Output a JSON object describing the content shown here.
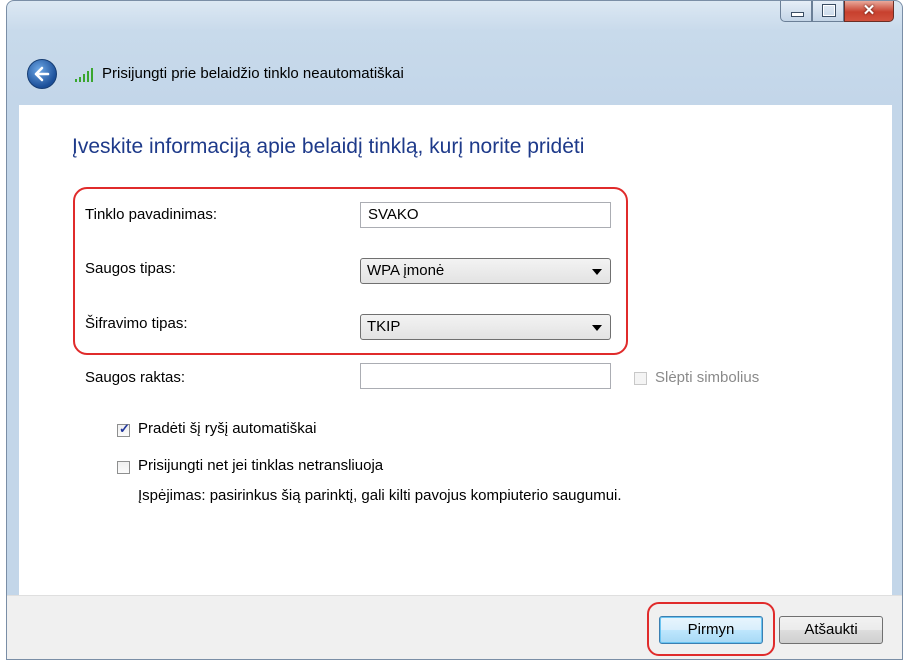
{
  "window": {
    "title": "Prisijungti prie belaidžio tinklo neautomatiškai",
    "controls": {
      "minimize": "minimize-icon",
      "maximize": "maximize-icon",
      "close": "close-icon"
    }
  },
  "form": {
    "heading": "Įveskite informaciją apie belaidį tinklą, kurį norite pridėti",
    "network_name": {
      "label": "Tinklo pavadinimas:",
      "value": "SVAKO"
    },
    "security_type": {
      "label": "Saugos tipas:",
      "value": "WPA įmonė"
    },
    "encryption_type": {
      "label": "Šifravimo tipas:",
      "value": "TKIP"
    },
    "security_key": {
      "label": "Saugos raktas:",
      "value": ""
    },
    "hide_characters": {
      "label": "Slėpti simbolius",
      "checked": false,
      "enabled": false
    },
    "start_automatically": {
      "label": "Pradėti šį ryšį automatiškai",
      "checked": true
    },
    "connect_if_not_broadcasting": {
      "label": "Prisijungti net jei tinklas netransliuoja",
      "checked": false
    },
    "warning": "Įspėjimas: pasirinkus šią parinktį, gali kilti pavojus kompiuterio saugumui."
  },
  "buttons": {
    "next": "Pirmyn",
    "cancel": "Atšaukti"
  },
  "colors": {
    "heading": "#1e3a8a",
    "highlight": "#e02b2b",
    "frame": "#c8daeb"
  }
}
